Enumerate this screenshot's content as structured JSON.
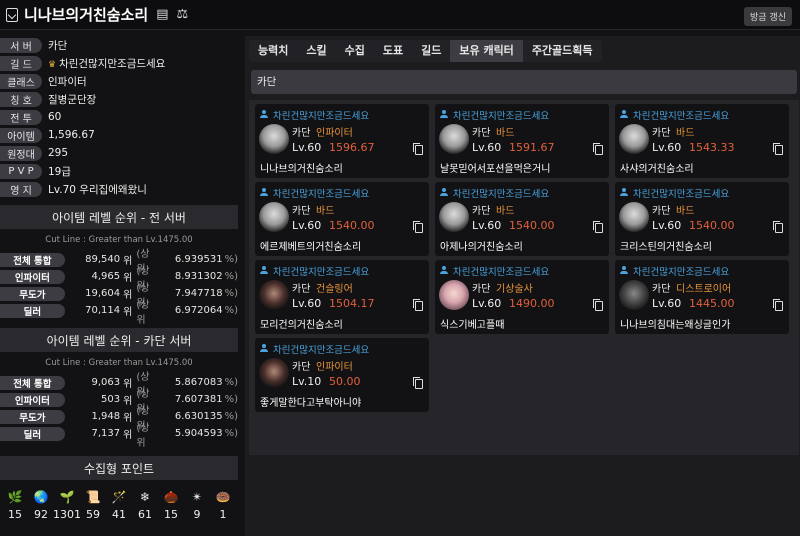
{
  "header": {
    "title": "니나브의거친숨소리",
    "refresh_label": "방금 갱신"
  },
  "profile": [
    {
      "label": "서 버",
      "value": "카단"
    },
    {
      "label": "길 드",
      "value": "차린건많지만조금드세요",
      "crown": true
    },
    {
      "label": "클래스",
      "value": "인파이터"
    },
    {
      "label": "칭 호",
      "value": "질병군단장"
    },
    {
      "label": "전 투",
      "value": "60"
    },
    {
      "label": "아이템",
      "value": "1,596.67"
    },
    {
      "label": "원정대",
      "value": "295"
    },
    {
      "label": "P V P",
      "value": "19급"
    },
    {
      "label": "영 지",
      "value": "Lv.70 우리집에왜왔니"
    }
  ],
  "rank_all": {
    "title": "아이템 레벨 순위 - 전 서버",
    "cutline": "Cut Line : Greater than Lv.1475.00",
    "rows": [
      {
        "label": "전체 통합",
        "rank": "89,540",
        "pct": "6.939531"
      },
      {
        "label": "인파이터",
        "rank": "4,965",
        "pct": "8.931302"
      },
      {
        "label": "무도가",
        "rank": "19,604",
        "pct": "7.947718"
      },
      {
        "label": "딜러",
        "rank": "70,114",
        "pct": "6.972064"
      }
    ]
  },
  "rank_server": {
    "title": "아이템 레벨 순위 - 카단 서버",
    "cutline": "Cut Line : Greater than Lv.1475.00",
    "rows": [
      {
        "label": "전체 통합",
        "rank": "9,063",
        "pct": "5.867083"
      },
      {
        "label": "인파이터",
        "rank": "503",
        "pct": "7.607381"
      },
      {
        "label": "무도가",
        "rank": "1,948",
        "pct": "6.630135"
      },
      {
        "label": "딜러",
        "rank": "7,137",
        "pct": "5.904593"
      }
    ]
  },
  "rank_labels": {
    "unit": "위",
    "paren_open": "(상위",
    "paren_close": "%)"
  },
  "collect": {
    "title": "수집형 포인트",
    "items": [
      {
        "icon": "island-heart-icon",
        "glyph": "🌿",
        "value": "15"
      },
      {
        "icon": "orpheus-star-icon",
        "glyph": "🌏",
        "value": "92"
      },
      {
        "icon": "mokoko-seed-icon",
        "glyph": "🌱",
        "value": "1301"
      },
      {
        "icon": "masterpiece-icon",
        "glyph": "📜",
        "value": "59"
      },
      {
        "icon": "giants-heart-icon",
        "glyph": "🪄",
        "value": "41"
      },
      {
        "icon": "ignea-token-icon",
        "glyph": "❄",
        "value": "61"
      },
      {
        "icon": "adventure-tome-icon",
        "glyph": "🌰",
        "value": "15"
      },
      {
        "icon": "world-tree-leaf-icon",
        "glyph": "✴",
        "value": "9"
      },
      {
        "icon": "sea-bounty-icon",
        "glyph": "🍩",
        "value": "1"
      }
    ]
  },
  "tabs": [
    "능력치",
    "스킬",
    "수집",
    "도표",
    "길드",
    "보유 캐릭터",
    "주간골드획득"
  ],
  "active_tab": 5,
  "server_bar": "카단",
  "characters": [
    {
      "guild": "차린건많지만조금드세요",
      "server": "카단",
      "class": "인파이터",
      "level": "Lv.60",
      "item_level": "1596.67",
      "name": "니나브의거친숨소리",
      "avatar": "light"
    },
    {
      "guild": "차린건많지만조금드세요",
      "server": "카단",
      "class": "바드",
      "level": "Lv.60",
      "item_level": "1591.67",
      "name": "날못믿어서포션을먹은거니",
      "avatar": "light"
    },
    {
      "guild": "차린건많지만조금드세요",
      "server": "카단",
      "class": "바드",
      "level": "Lv.60",
      "item_level": "1543.33",
      "name": "사샤의거친숨소리",
      "avatar": "light"
    },
    {
      "guild": "차린건많지만조금드세요",
      "server": "카단",
      "class": "바드",
      "level": "Lv.60",
      "item_level": "1540.00",
      "name": "에르제베트의거친숨소리",
      "avatar": "light"
    },
    {
      "guild": "차린건많지만조금드세요",
      "server": "카단",
      "class": "바드",
      "level": "Lv.60",
      "item_level": "1540.00",
      "name": "아제나의거친숨소리",
      "avatar": "light"
    },
    {
      "guild": "차린건많지만조금드세요",
      "server": "카단",
      "class": "바드",
      "level": "Lv.60",
      "item_level": "1540.00",
      "name": "크리스틴의거친숨소리",
      "avatar": "light"
    },
    {
      "guild": "차린건많지만조금드세요",
      "server": "카단",
      "class": "건슬링어",
      "level": "Lv.60",
      "item_level": "1504.17",
      "name": "모리건의거친숨소리",
      "avatar": "dark"
    },
    {
      "guild": "차린건많지만조금드세요",
      "server": "카단",
      "class": "기상술사",
      "level": "Lv.60",
      "item_level": "1490.00",
      "name": "식스기베고플때",
      "avatar": "pink"
    },
    {
      "guild": "차린건많지만조금드세요",
      "server": "카단",
      "class": "디스트로이어",
      "level": "Lv.60",
      "item_level": "1445.00",
      "name": "니나브의침대는왜싱글인가",
      "avatar": "gray"
    },
    {
      "guild": "차린건많지만조금드세요",
      "server": "카단",
      "class": "인파이터",
      "level": "Lv.10",
      "item_level": "50.00",
      "name": "좋게말한다고부탁아니야",
      "avatar": "dark"
    }
  ]
}
